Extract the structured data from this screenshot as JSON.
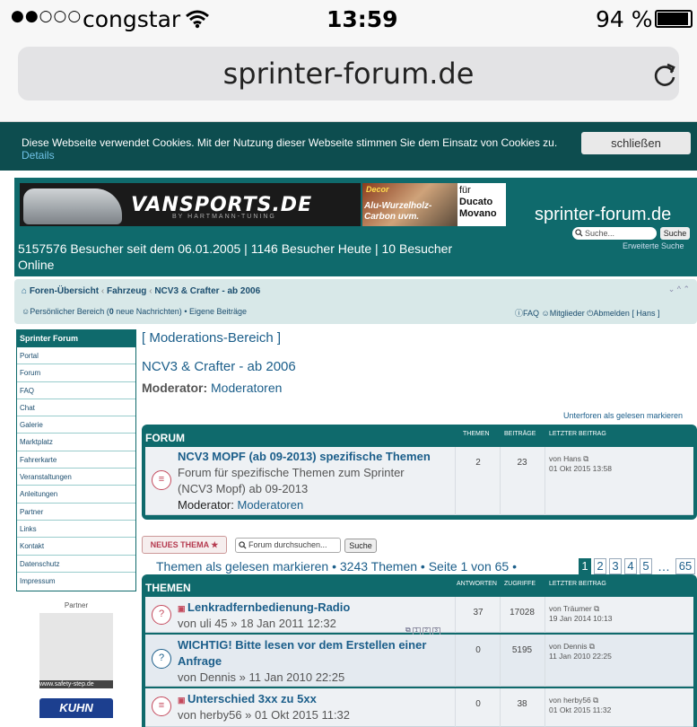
{
  "status_bar": {
    "signal": "●●○○○",
    "carrier": "congstar",
    "time": "13:59",
    "battery": "94 %"
  },
  "browser": {
    "url": "sprinter-forum.de",
    "reload_icon": "reload-icon"
  },
  "cookie_notice": {
    "text": "Diese Webseite verwendet Cookies. Mit der Nutzung dieser Webseite stimmen Sie dem Einsatz von Cookies zu.",
    "details": "Details",
    "close": "schließen"
  },
  "header": {
    "banner_text": "VANSPORTS.DE",
    "banner_sub": "BY HARTMANN-TUNING",
    "ad2_line1": "Decor",
    "ad2_line2": "Alu-Wurzelholz-",
    "ad2_line3": "Carbon uvm.",
    "ad3_text": [
      "für",
      "Ducato",
      "Movano"
    ],
    "site_name": "sprinter-forum.de",
    "search_placeholder": "Suche...",
    "search_button": "Suche",
    "advanced_search": "Erweiterte Suche",
    "visitors": "5157576 Besucher seit dem 06.01.2005 | 1146 Besucher Heute | 10 Besucher Online"
  },
  "nav": {
    "breadcrumb": [
      "Foren-Übersicht",
      "Fahrzeug",
      "NCV3 & Crafter - ab 2006"
    ],
    "personal": "Persönlicher Bereich (",
    "new_count": "0",
    "new_messages": " neue Nachrichten)",
    "own_posts": "Eigene Beiträge",
    "faq": "FAQ",
    "members": "Mitglieder",
    "logout": "Abmelden [ Hans ]"
  },
  "sidebar": {
    "title": "Sprinter Forum",
    "items": [
      "Portal",
      "Forum",
      "FAQ",
      "Chat",
      "Galerie",
      "Marktplatz",
      "Fahrerkarte",
      "Veranstaltungen",
      "Anleitungen",
      "Partner",
      "Links",
      "Kontakt",
      "Datenschutz",
      "Impressum"
    ],
    "partner_label": "Partner",
    "partner_caption": "www.safety-step.de",
    "kuhn": "KUHN"
  },
  "main": {
    "mod_area": "[ Moderations-Bereich ]",
    "forum_title": "NCV3 & Crafter - ab 2006",
    "moderator_label": "Moderator:",
    "moderator_value": "Moderatoren",
    "mark_subforums": "Unterforen als gelesen markieren"
  },
  "forum_box": {
    "header": "FORUM",
    "col_topics": "THEMEN",
    "col_posts": "BEITRÄGE",
    "col_last": "LETZTER BEITRAG",
    "row": {
      "title": "NCV3 MOPF (ab 09-2013) spezifische Themen",
      "desc1": "Forum für spezifische Themen zum Sprinter",
      "desc2": "(NCV3 Mopf) ab 09-2013",
      "mod_label": "Moderator:",
      "mod_value": "Moderatoren",
      "topics": "2",
      "posts": "23",
      "last_by": "von Hans",
      "last_date": "01 Okt 2015 13:58"
    }
  },
  "toolbar": {
    "new_topic": "NEUES THEMA ★",
    "search_placeholder": "Forum durchsuchen...",
    "search_button": "Suche",
    "pagination_info": "Themen als gelesen markieren • 3243 Themen • Seite 1 von 65 •",
    "pages": [
      "1",
      "2",
      "3",
      "4",
      "5"
    ],
    "ellipsis": "…",
    "last_page": "65"
  },
  "topics_box": {
    "header": "THEMEN",
    "col_answers": "ANTWORTEN",
    "col_views": "ZUGRIFFE",
    "col_last": "LETZTER BEITRAG",
    "rows": [
      {
        "title": "Lenkradfernbedienung-Radio",
        "by": "von uli 45 » 18 Jan 2011 12:32",
        "answers": "37",
        "views": "17028",
        "last_by": "von Träumer",
        "last_date": "19 Jan 2014 10:13",
        "pages": [
          "1",
          "2",
          "3"
        ],
        "icon": "?"
      },
      {
        "title": "WICHTIG! Bitte lesen vor dem Erstellen einer",
        "title2": "Anfrage",
        "by": "von Dennis » 11 Jan 2010 22:25",
        "answers": "0",
        "views": "5195",
        "last_by": "von Dennis",
        "last_date": "11 Jan 2010 22:25",
        "icon": "?"
      },
      {
        "title": "Unterschied 3xx zu 5xx",
        "by": "von herby56 » 01 Okt 2015 11:32",
        "answers": "0",
        "views": "38",
        "last_by": "von herby56",
        "last_date": "01 Okt 2015 11:32",
        "icon": "≡"
      }
    ]
  }
}
